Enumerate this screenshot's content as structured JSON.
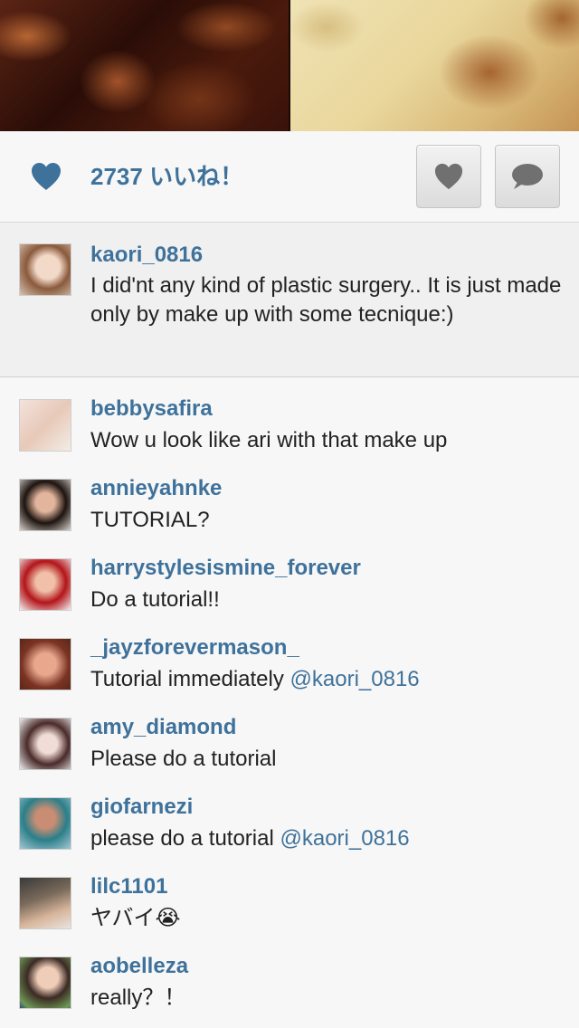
{
  "like_bar": {
    "like_count_text": "2737 いいね！"
  },
  "caption": {
    "username": "kaori_0816",
    "text": "I did'nt any kind of plastic surgery.. It is just made only by make up with some tecnique:)"
  },
  "comments": [
    {
      "username": "bebbysafira",
      "text": "Wow u look like ari with that make up",
      "mention": ""
    },
    {
      "username": "annieyahnke",
      "text": "TUTORIAL?",
      "mention": ""
    },
    {
      "username": "harrystylesismine_forever",
      "text": "Do a tutorial!!",
      "mention": ""
    },
    {
      "username": "_jayzforevermason_",
      "text": "Tutorial immediately ",
      "mention": "@kaori_0816"
    },
    {
      "username": "amy_diamond",
      "text": "Please do a tutorial",
      "mention": ""
    },
    {
      "username": "giofarnezi",
      "text": "please do a tutorial ",
      "mention": "@kaori_0816"
    },
    {
      "username": "lilc1101",
      "text": "ヤバイ😭",
      "mention": ""
    },
    {
      "username": "aobelleza",
      "text": "really？！",
      "mention": ""
    }
  ],
  "colors": {
    "link": "#3f729b",
    "text": "#222222",
    "background": "#f7f7f7"
  },
  "icons": {
    "like_indicator": "heart-icon",
    "like_button": "heart-icon",
    "comment_button": "speech-bubble-icon"
  }
}
